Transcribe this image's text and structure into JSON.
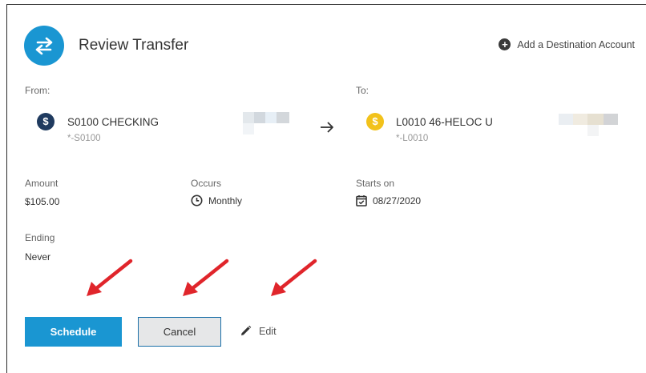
{
  "header": {
    "title": "Review Transfer",
    "add_destination_label": "Add a Destination Account"
  },
  "from": {
    "label": "From:",
    "account_name": "S0100 CHECKING",
    "account_number": "*-S0100",
    "icon_symbol": "$",
    "icon_color": "#1f3a5f"
  },
  "to": {
    "label": "To:",
    "account_name": "L0010 46-HELOC U",
    "account_number": "*-L0010",
    "icon_symbol": "$",
    "icon_color": "#f2c21b"
  },
  "details": {
    "amount_label": "Amount",
    "amount_value": "$105.00",
    "occurs_label": "Occurs",
    "occurs_value": "Monthly",
    "starts_label": "Starts on",
    "starts_value": "08/27/2020",
    "ending_label": "Ending",
    "ending_value": "Never"
  },
  "actions": {
    "schedule_label": "Schedule",
    "cancel_label": "Cancel",
    "edit_label": "Edit"
  },
  "colors": {
    "accent": "#1a96d2",
    "annotation_arrow": "#e0252b"
  }
}
